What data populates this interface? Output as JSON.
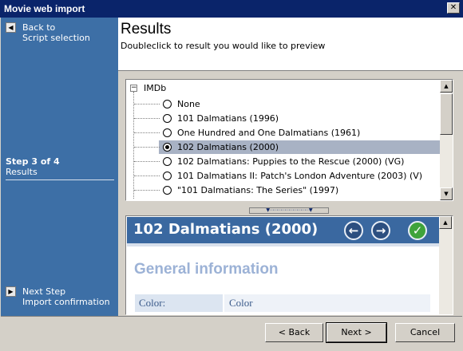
{
  "window": {
    "title": "Movie web import",
    "close_glyph": "✕"
  },
  "sidebar": {
    "back": {
      "line1": "Back to",
      "line2": "Script selection",
      "icon": "left-arrow-icon"
    },
    "step": {
      "title": "Step 3 of 4",
      "subtitle": "Results"
    },
    "next": {
      "line1": "Next Step",
      "line2": "Import confirmation",
      "icon": "right-arrow-icon"
    }
  },
  "header": {
    "title": "Results",
    "subtitle": "Doubleclick to result you would like to preview"
  },
  "tree": {
    "root": "IMDb",
    "items": [
      {
        "label": "None",
        "selected": false
      },
      {
        "label": "101 Dalmatians (1996)",
        "selected": false
      },
      {
        "label": "One Hundred and One Dalmatians (1961)",
        "selected": false
      },
      {
        "label": "102 Dalmatians (2000)",
        "selected": true
      },
      {
        "label": "102 Dalmatians: Puppies to the Rescue (2000) (VG)",
        "selected": false
      },
      {
        "label": "101 Dalmatians II: Patch's London Adventure (2003) (V)",
        "selected": false
      },
      {
        "label": "\"101 Dalmatians: The Series\" (1997)",
        "selected": false
      }
    ]
  },
  "preview": {
    "title": "102 Dalmatians (2000)",
    "section": "General information",
    "rows": [
      {
        "key": "Color:",
        "value": "Color"
      }
    ],
    "icons": [
      "back-arrow-icon",
      "forward-arrow-icon",
      "imdb-globe-icon"
    ]
  },
  "footer": {
    "back_label": "< Back",
    "next_label": "Next >",
    "cancel_label": "Cancel"
  },
  "colors": {
    "sidebar": "#3d6fa6",
    "title_bar": "#0a246a",
    "selection": "#a8b2c4",
    "preview_header": "#3a68a0"
  }
}
